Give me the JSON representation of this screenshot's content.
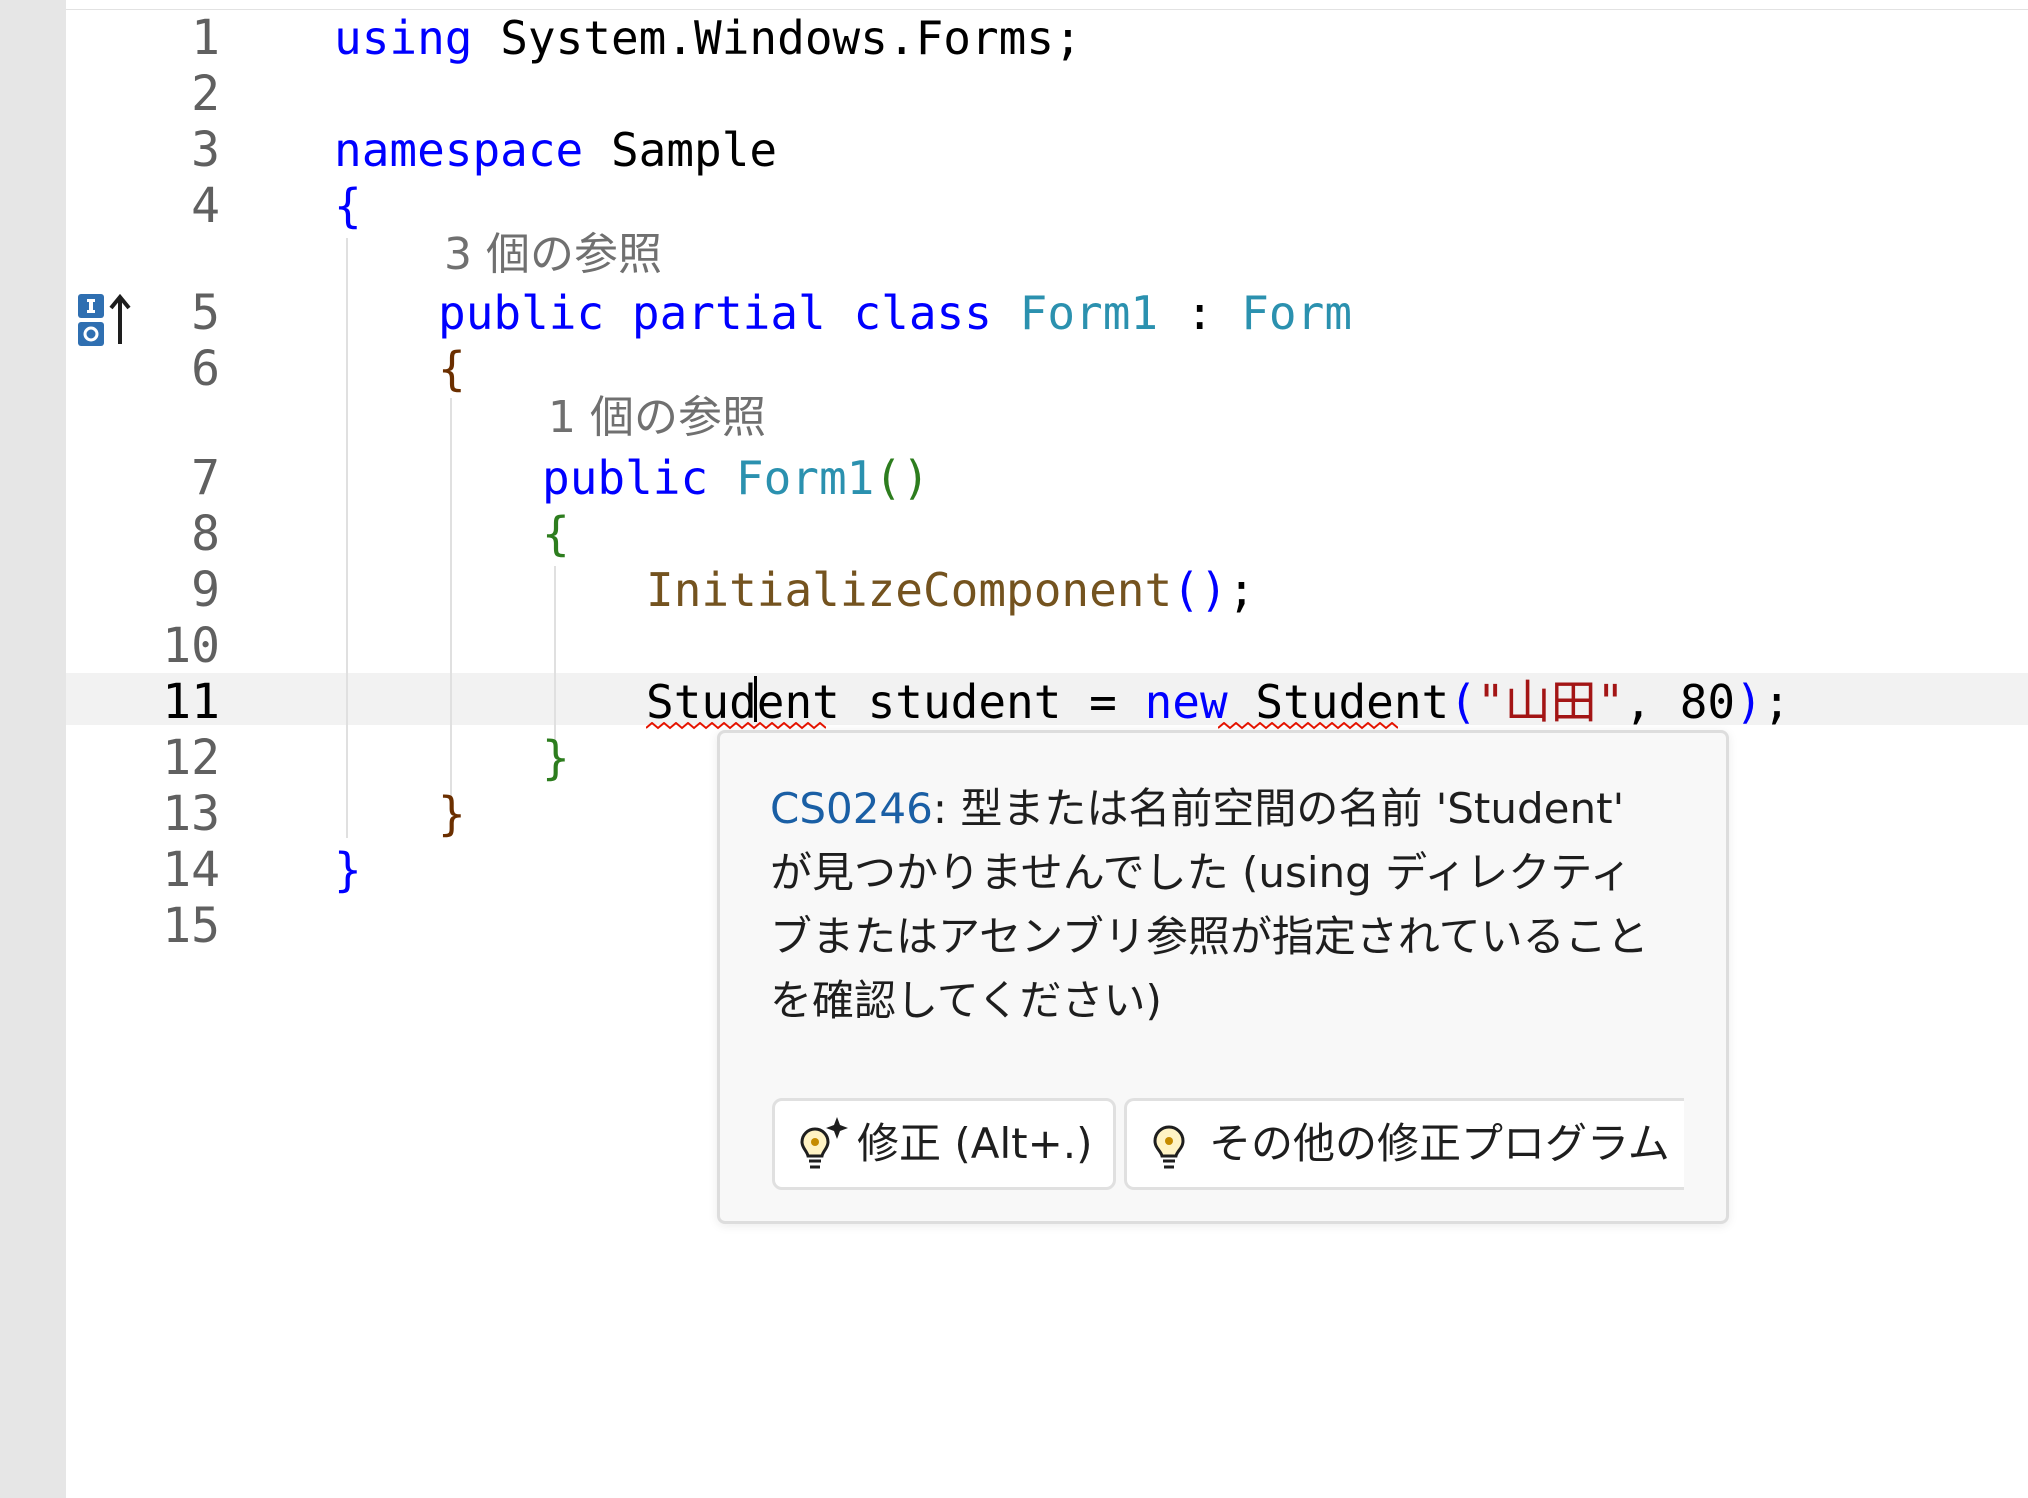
{
  "editor": {
    "line_numbers": [
      "1",
      "2",
      "3",
      "4",
      "5",
      "6",
      "7",
      "8",
      "9",
      "10",
      "11",
      "12",
      "13",
      "14",
      "15"
    ],
    "active_line": "11",
    "lines": {
      "l1": {
        "kw": "using",
        "rest": "System.Windows.Forms;"
      },
      "l3": {
        "kw": "namespace",
        "name": "Sample"
      },
      "l4": {
        "brace": "{"
      },
      "ref_class": "3 個の参照",
      "l5": {
        "kw1": "public",
        "kw2": "partial",
        "kw3": "class",
        "type1": "Form1",
        "colon": ":",
        "type2": "Form"
      },
      "l6": {
        "brace": "{"
      },
      "ref_ctor": "1 個の参照",
      "l7": {
        "kw": "public",
        "type": "Form1",
        "parens": "()"
      },
      "l8": {
        "brace": "{"
      },
      "l9": {
        "method": "InitializeComponent",
        "parens": "()",
        "semi": ";"
      },
      "l11": {
        "type1": "Student",
        "var": "student",
        "eq": "=",
        "kw": "new",
        "type2": "Student",
        "open": "(",
        "str": "\"山田\"",
        "comma": ",",
        "num": "80",
        "close": ")",
        "semi": ";"
      },
      "l12": {
        "brace": "}"
      },
      "l13": {
        "brace": "}"
      },
      "l14": {
        "brace": "}"
      }
    }
  },
  "tooltip": {
    "error_code": "CS0246",
    "message": ": 型または名前空間の名前 'Student' が見つかりませんでした (using ディレクティブまたはアセンブリ参照が指定されていることを確認してください)",
    "fix_button": "修正 (Alt+.)",
    "more_fixes_button": "その他の修正プログラム (A"
  },
  "colors": {
    "keyword": "#0000ff",
    "type": "#2b91af",
    "method": "#74531f",
    "string": "#a31515",
    "error_squiggle": "#e51400",
    "error_code": "#1a5fa5"
  },
  "icons": {
    "gutter": "implements-icon",
    "fix": "sparkle-lightbulb-icon",
    "more_fixes": "lightbulb-icon"
  }
}
